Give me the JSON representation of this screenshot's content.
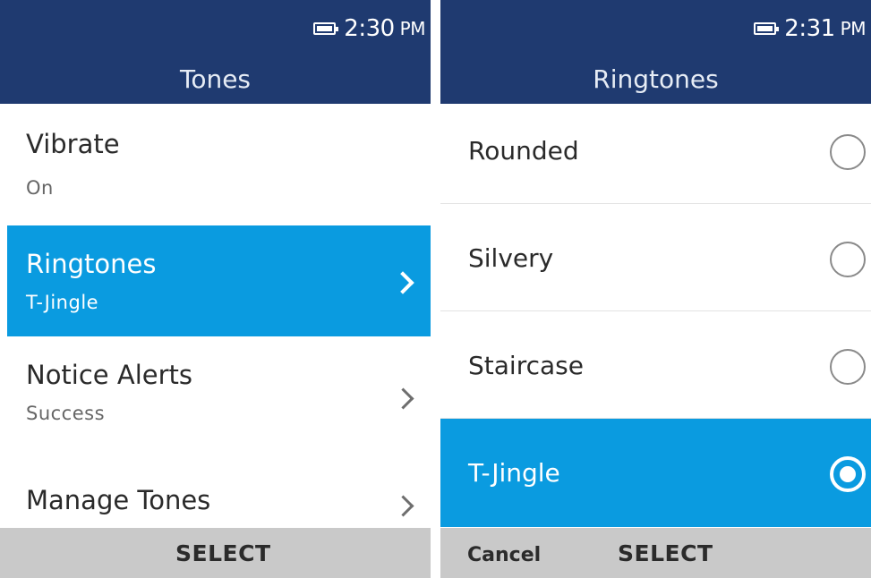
{
  "left": {
    "status_time": "2:30",
    "status_ampm": "PM",
    "title": "Tones",
    "items": [
      {
        "label": "Vibrate",
        "value": "On"
      },
      {
        "label": "Ringtones",
        "value": "T-Jingle"
      },
      {
        "label": "Notice Alerts",
        "value": "Success"
      },
      {
        "label": "Manage Tones"
      }
    ],
    "softkey_center": "SELECT"
  },
  "right": {
    "status_time": "2:31",
    "status_ampm": "PM",
    "title": "Ringtones",
    "options": [
      {
        "label": "Rounded",
        "selected": false
      },
      {
        "label": "Silvery",
        "selected": false
      },
      {
        "label": "Staircase",
        "selected": false
      },
      {
        "label": "T-Jingle",
        "selected": true
      }
    ],
    "softkey_left": "Cancel",
    "softkey_center": "SELECT"
  },
  "colors": {
    "header_bg": "#1f3a70",
    "highlight": "#0a9be0",
    "softkey_bg": "#c9c9c9"
  },
  "icons": {
    "battery": "battery-icon",
    "chevron": "chevron-right-icon",
    "radio": "radio-button-icon"
  }
}
